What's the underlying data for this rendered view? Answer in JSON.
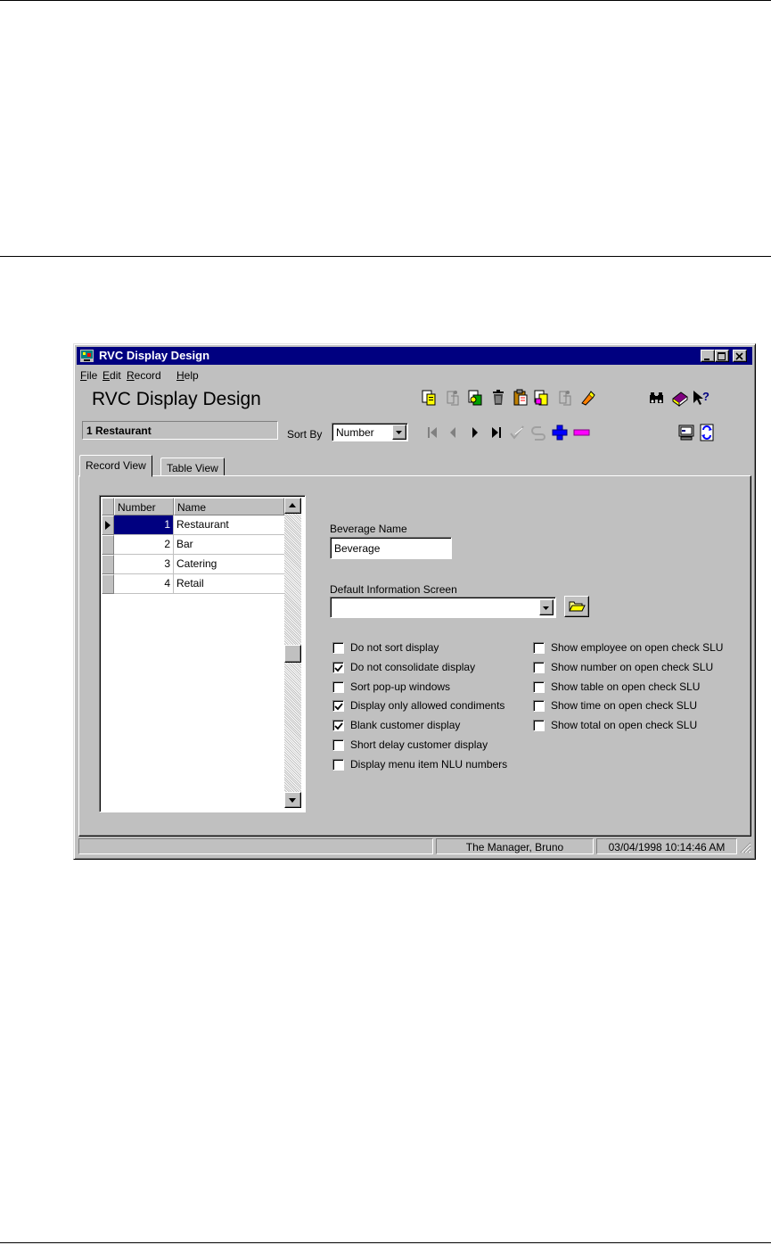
{
  "window": {
    "title": "RVC Display Design",
    "buttons": [
      "minimize",
      "maximize",
      "close"
    ]
  },
  "menu": {
    "items": [
      {
        "label": "File",
        "accel": "F",
        "rest": "ile"
      },
      {
        "label": "Edit",
        "accel": "E",
        "rest": "dit"
      },
      {
        "label": "Record",
        "accel": "R",
        "rest": "ecord"
      },
      {
        "label": "Help",
        "accel": "H",
        "rest": "elp"
      }
    ]
  },
  "header": {
    "title": "RVC Display Design",
    "current_record": "1 Restaurant",
    "sort_by_label": "Sort By",
    "sort_by_value": "Number"
  },
  "toolbar": {
    "icons": [
      "new-record-icon",
      "copy-record-icon",
      "find-record-icon",
      "delete-icon",
      "paste-icon",
      "duplicate-icon",
      "undo-icon",
      "clear-icon",
      "binoculars-icon",
      "book-icon",
      "help-pointer-icon",
      "first-record-icon",
      "previous-record-icon",
      "next-record-icon",
      "last-record-icon",
      "confirm-icon",
      "revert-icon",
      "add-icon",
      "remove-icon",
      "monitor-icon",
      "refresh-icon"
    ]
  },
  "tabs": [
    {
      "label": "Record View",
      "active": true
    },
    {
      "label": "Table View",
      "active": false
    }
  ],
  "grid": {
    "columns": [
      "Number",
      "Name"
    ],
    "rows": [
      {
        "number": "1",
        "name": "Restaurant",
        "selected": true
      },
      {
        "number": "2",
        "name": "Bar",
        "selected": false
      },
      {
        "number": "3",
        "name": "Catering",
        "selected": false
      },
      {
        "number": "4",
        "name": "Retail",
        "selected": false
      }
    ]
  },
  "form": {
    "beverage_name_label": "Beverage Name",
    "beverage_name_value": "Beverage",
    "default_info_label": "Default Information Screen",
    "default_info_value": "",
    "checkboxes_left": [
      {
        "label": "Do not sort display",
        "checked": false
      },
      {
        "label": "Do not consolidate display",
        "checked": true
      },
      {
        "label": "Sort pop-up windows",
        "checked": false
      },
      {
        "label": "Display only allowed condiments",
        "checked": true
      },
      {
        "label": "Blank customer display",
        "checked": true
      },
      {
        "label": "Short delay customer display",
        "checked": false
      },
      {
        "label": "Display menu item NLU numbers",
        "checked": false
      }
    ],
    "checkboxes_right": [
      {
        "label": "Show employee on open check SLU",
        "checked": false
      },
      {
        "label": "Show number on open check SLU",
        "checked": false
      },
      {
        "label": "Show table on open check SLU",
        "checked": false
      },
      {
        "label": "Show time on open check SLU",
        "checked": false
      },
      {
        "label": "Show total on open check SLU",
        "checked": false
      }
    ]
  },
  "status": {
    "message": "",
    "user": "The Manager, Bruno",
    "datetime": "03/04/1998 10:14:46 AM"
  },
  "colors": {
    "titlebar": "#000080",
    "face": "#c0c0c0",
    "selection": "#000080",
    "add": "#0000ff",
    "remove": "#ff00ff"
  }
}
